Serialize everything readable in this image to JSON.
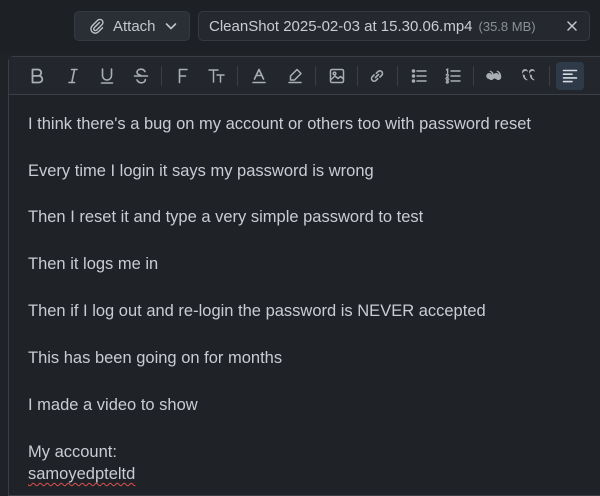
{
  "attach": {
    "label": "Attach",
    "icons": [
      "paperclip-icon",
      "chevron-down-icon"
    ]
  },
  "file": {
    "name": "CleanShot 2025-02-03 at 15.30.06.mp4",
    "size": "(35.8 MB)",
    "remove_icon": "close-icon"
  },
  "toolbar": {
    "buttons": [
      "bold",
      "italic",
      "underline",
      "strikethrough",
      "font",
      "text-size",
      "text-color",
      "highlight",
      "image",
      "link",
      "bullet-list",
      "numbered-list",
      "quote-open",
      "quote-close",
      "align-left"
    ],
    "active": "align-left"
  },
  "body": {
    "lines": [
      "I think there's a bug on my account or others too with password reset",
      "Every time I login it says my password is wrong",
      "Then I reset it and type a very simple password to test",
      "Then it logs me in",
      "Then if I log out and re-login the password is NEVER accepted",
      "This has been going on for months",
      "I made a video to show",
      "My account:"
    ],
    "account": "samoyedpteltd"
  },
  "colors": {
    "background": "#1f2227",
    "text": "#c9cdd3",
    "border": "#3a3f47",
    "active": "#2f3a48",
    "spellcheck": "#d9534f"
  }
}
